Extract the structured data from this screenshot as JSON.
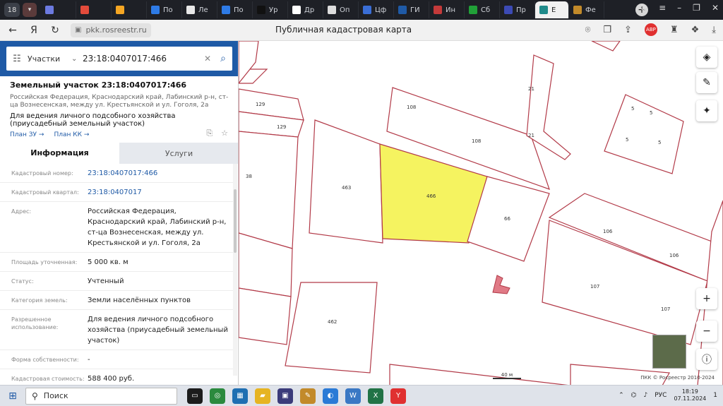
{
  "browser": {
    "tab_counter": "18",
    "tabs": [
      {
        "label": "",
        "color": "#6c7ae0"
      },
      {
        "label": "",
        "color": "#e34b3b"
      },
      {
        "label": "",
        "color": "#f5a623"
      },
      {
        "label": "По",
        "color": "#2e7be6"
      },
      {
        "label": "Ле",
        "color": "#e8e8e8"
      },
      {
        "label": "По",
        "color": "#2e7be6"
      },
      {
        "label": "Ур",
        "color": "#111111"
      },
      {
        "label": "Др",
        "color": "#ffffff"
      },
      {
        "label": "Оп",
        "color": "#dddddd"
      },
      {
        "label": "Цф",
        "color": "#3a6ed6"
      },
      {
        "label": "ГИ",
        "color": "#1f5aa6"
      },
      {
        "label": "Ин",
        "color": "#c43a3a"
      },
      {
        "label": "Сб",
        "color": "#21a038"
      },
      {
        "label": "Пр",
        "color": "#3c4ab5"
      },
      {
        "label": "Е",
        "color": "#1f8a8a"
      },
      {
        "label": "Фе",
        "color": "#c28a2a"
      }
    ],
    "active_tab_index": 14,
    "url": "pkk.rosreestr.ru",
    "page_title": "Публичная кадастровая карта",
    "adblock_label": "ABP"
  },
  "search": {
    "type_label": "Участки",
    "value": "23:18:0407017:466"
  },
  "object": {
    "title": "Земельный участок 23:18:0407017:466",
    "address_short": "Российская Федерация, Краснодарский край, Лабинский р-н, ст-ца Вознесенская, между ул. Крестьянской и ул. Гоголя, 2а",
    "use": "Для ведения личного подсобного хозяйства (приусадебный земельный участок)",
    "plan_zu": "План ЗУ →",
    "plan_kk": "План КК →"
  },
  "info_tabs": {
    "info": "Информация",
    "services": "Услуги"
  },
  "rows": [
    {
      "label": "Кадастровый номер:",
      "value": "23:18:0407017:466",
      "link": true
    },
    {
      "label": "Кадастровый квартал:",
      "value": "23:18:0407017",
      "link": true
    },
    {
      "label": "Адрес:",
      "value": "Российская Федерация, Краснодарский край, Лабинский р-н, ст-ца Вознесенская, между ул. Крестьянской и ул. Гоголя, 2а",
      "link": false
    },
    {
      "label": "Площадь уточненная:",
      "value": "5 000 кв. м",
      "link": false
    },
    {
      "label": "Статус:",
      "value": "Учтенный",
      "link": false
    },
    {
      "label": "Категория земель:",
      "value": "Земли населённых пунктов",
      "link": false
    },
    {
      "label": "Разрешенное использование:",
      "value": "Для ведения личного подсобного хозяйства (приусадебный земельный участок)",
      "link": false
    },
    {
      "label": "Форма собственности:",
      "value": "-",
      "link": false
    },
    {
      "label": "Кадастровая стоимость:",
      "value": "588 400 руб.",
      "link": false
    }
  ],
  "map": {
    "parcel_labels": {
      "p129a": "129",
      "p129b": "129",
      "p38": "38",
      "p108a": "108",
      "p108b": "108",
      "p21a": "21",
      "p21b": "21",
      "p5a": "5",
      "p5b": "5",
      "p5c": "5",
      "p5d": "5",
      "p463": "463",
      "p466": "466",
      "p66": "66",
      "p106a": "106",
      "p106b": "106",
      "p107a": "107",
      "p107b": "107",
      "p462": "462"
    },
    "scale_label": "40 м",
    "attribution": "ПКК © Росреестр 2010-2024"
  },
  "taskbar": {
    "search_placeholder": "Поиск",
    "lang": "РУС",
    "time": "18:19",
    "date": "07.11.2024",
    "notif_count": "1"
  }
}
